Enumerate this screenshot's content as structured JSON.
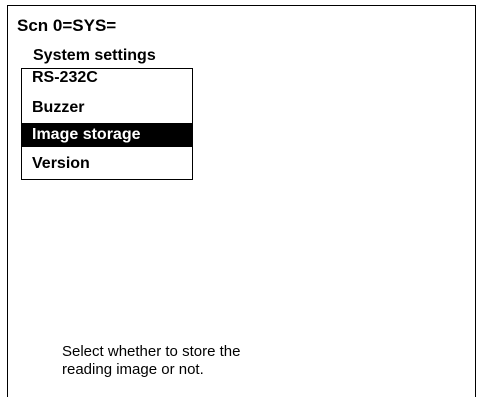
{
  "screen": {
    "title": "Scn 0=SYS="
  },
  "menu": {
    "heading": "System settings",
    "items": [
      {
        "label": "RS-232C",
        "selected": false
      },
      {
        "label": "Buzzer",
        "selected": false
      },
      {
        "label": "Image storage",
        "selected": true
      },
      {
        "label": "Version",
        "selected": false
      }
    ]
  },
  "help": {
    "line1": "Select whether to store the",
    "line2": "reading image or not."
  },
  "colors": {
    "background": "#ffffff",
    "foreground": "#000000",
    "selection_background": "#000000",
    "selection_text": "#ffffff"
  }
}
